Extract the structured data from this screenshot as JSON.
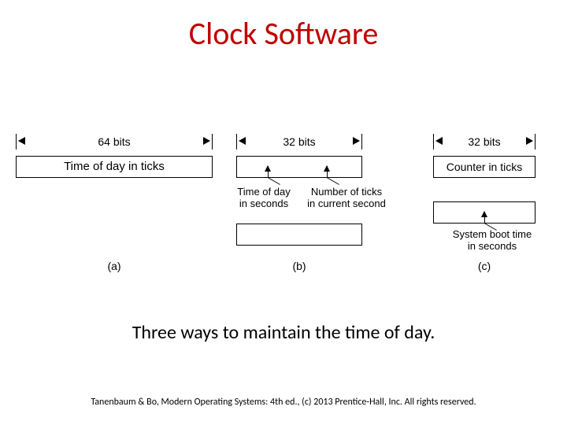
{
  "title": "Clock Software",
  "caption": "Three ways to maintain the time of day.",
  "footer": "Tanenbaum & Bo, Modern  Operating Systems: 4th ed., (c) 2013 Prentice-Hall, Inc. All rights reserved.",
  "figure": {
    "a": {
      "width_label": "64 bits",
      "box": "Time of day in ticks",
      "letter": "(a)"
    },
    "b": {
      "width_label": "32 bits",
      "left_label": "Time of day\nin seconds",
      "right_label": "Number of ticks\nin current second",
      "letter": "(b)"
    },
    "c": {
      "width_label": "32 bits",
      "box": "Counter in ticks",
      "bottom_label": "System boot time\nin seconds",
      "letter": "(c)"
    }
  }
}
